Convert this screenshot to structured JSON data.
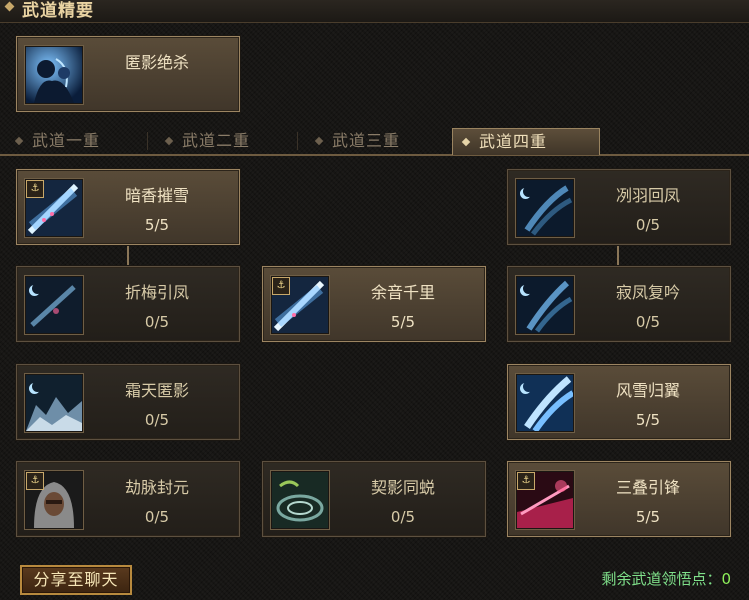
{
  "window": {
    "title": "武道精要"
  },
  "featured": {
    "name": "匿影绝杀"
  },
  "tabs": [
    {
      "label": "武道一重",
      "active": false
    },
    {
      "label": "武道二重",
      "active": false
    },
    {
      "label": "武道三重",
      "active": false
    },
    {
      "label": "武道四重",
      "active": true
    }
  ],
  "skills": [
    {
      "name": "暗香摧雪",
      "level": "5/5",
      "icon": "ice-blade-icon",
      "learned": true
    },
    {
      "name": "冽羽回凤",
      "level": "0/5",
      "icon": "frost-wing-icon",
      "learned": false
    },
    {
      "name": "折梅引凤",
      "level": "0/5",
      "icon": "plum-blossom-icon",
      "learned": false
    },
    {
      "name": "余音千里",
      "level": "5/5",
      "icon": "ice-blade-icon",
      "learned": true
    },
    {
      "name": "寂凤复吟",
      "level": "0/5",
      "icon": "frost-wing-icon",
      "learned": false
    },
    {
      "name": "霜天匿影",
      "level": "0/5",
      "icon": "frost-cliff-icon",
      "learned": false
    },
    {
      "name": "风雪归翼",
      "level": "5/5",
      "icon": "frost-wing-icon",
      "learned": true
    },
    {
      "name": "劫脉封元",
      "level": "0/5",
      "icon": "hooded-figure-icon",
      "learned": false
    },
    {
      "name": "契影同蜕",
      "level": "0/5",
      "icon": "shadow-vortex-icon",
      "learned": false
    },
    {
      "name": "三叠引锋",
      "level": "5/5",
      "icon": "crimson-sword-icon",
      "learned": true
    }
  ],
  "footer": {
    "share_label": "分享至聊天",
    "points_label": "剩余武道领悟点：",
    "points_value": "0"
  }
}
